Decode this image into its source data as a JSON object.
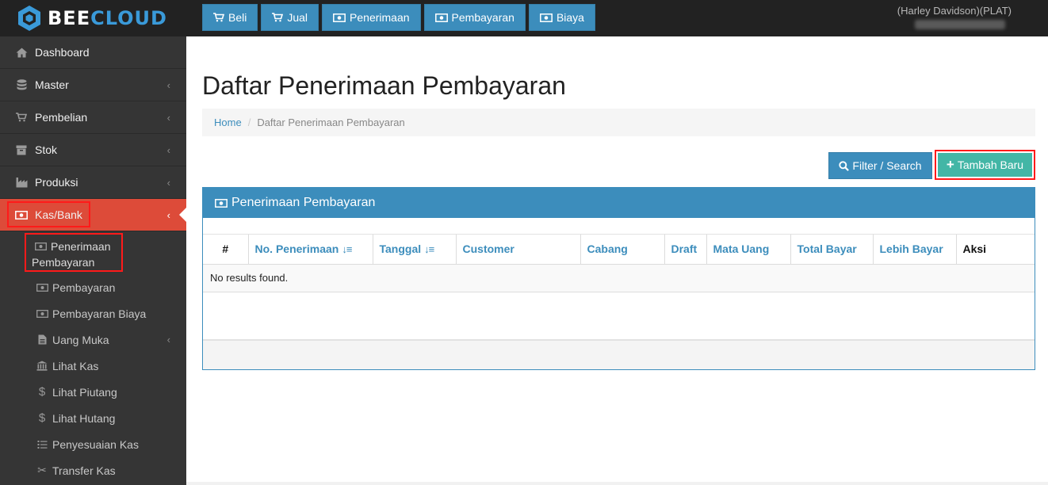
{
  "brand": {
    "name_part1": "BEE",
    "name_part2": "CLOUD"
  },
  "topnav": [
    {
      "label": "Beli",
      "icon": "cart-icon"
    },
    {
      "label": "Jual",
      "icon": "cart-icon"
    },
    {
      "label": "Penerimaan",
      "icon": "money-icon"
    },
    {
      "label": "Pembayaran",
      "icon": "money-icon"
    },
    {
      "label": "Biaya",
      "icon": "money-icon"
    }
  ],
  "user": {
    "name": "(Harley Davidson)(PLAT)"
  },
  "sidebar": {
    "items": [
      {
        "label": "Dashboard",
        "icon": "home-icon"
      },
      {
        "label": "Master",
        "icon": "database-icon"
      },
      {
        "label": "Pembelian",
        "icon": "cart-icon"
      },
      {
        "label": "Stok",
        "icon": "box-icon"
      },
      {
        "label": "Produksi",
        "icon": "factory-icon"
      },
      {
        "label": "Kas/Bank",
        "icon": "money-icon"
      }
    ],
    "subitems": [
      {
        "label_line1": "Penerimaan",
        "label_line2": "Pembayaran",
        "icon": "money-icon"
      },
      {
        "label": "Pembayaran",
        "icon": "money-icon"
      },
      {
        "label": "Pembayaran Biaya",
        "icon": "money-icon"
      },
      {
        "label": "Uang Muka",
        "icon": "file-icon"
      },
      {
        "label": "Lihat Kas",
        "icon": "bank-icon"
      },
      {
        "label": "Lihat Piutang",
        "icon": "dollar-icon"
      },
      {
        "label": "Lihat Hutang",
        "icon": "dollar-icon"
      },
      {
        "label": "Penyesuaian Kas",
        "icon": "list-icon"
      },
      {
        "label": "Transfer Kas",
        "icon": "scissors-icon"
      }
    ]
  },
  "page": {
    "title": "Daftar Penerimaan Pembayaran",
    "breadcrumb": {
      "home": "Home",
      "current": "Daftar Penerimaan Pembayaran"
    }
  },
  "actions": {
    "filter_label": "Filter / Search",
    "add_label": "Tambah Baru"
  },
  "panel": {
    "title": "Penerimaan Pembayaran",
    "columns": [
      "#",
      "No. Penerimaan",
      "Tanggal",
      "Customer",
      "Cabang",
      "Draft",
      "Mata Uang",
      "Total Bayar",
      "Lebih Bayar",
      "Aksi"
    ],
    "empty_message": "No results found."
  },
  "colors": {
    "accent": "#3c8dbc",
    "active": "#dd4b39",
    "add": "#43b6a6",
    "highlight": "#ff1a1a"
  }
}
